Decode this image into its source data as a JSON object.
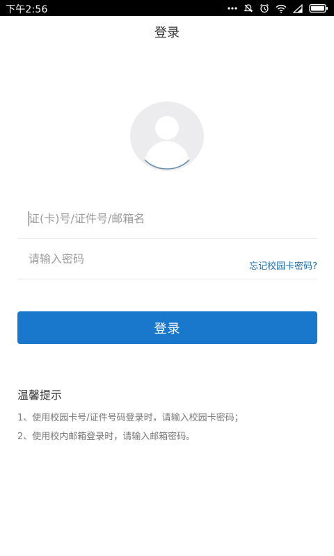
{
  "status_bar": {
    "time": "下午2:56",
    "icons": [
      "more-dots-icon",
      "mute-icon",
      "alarm-icon",
      "wifi-icon",
      "signal-icon",
      "battery-icon"
    ]
  },
  "header": {
    "title": "登录"
  },
  "avatar": {
    "icon": "default-avatar-icon"
  },
  "form": {
    "account_placeholder": "证(卡)号/证件号/邮箱名",
    "account_value": "",
    "password_placeholder": "请输入密码",
    "password_value": "",
    "forgot_label": "忘记校园卡密码?",
    "login_label": "登录"
  },
  "tips": {
    "title": "温馨提示",
    "items": [
      "1、使用校园卡号/证件号码登录时，请输入校园卡密码；",
      "2、使用校内邮箱登录时，请输入邮箱密码。"
    ]
  },
  "colors": {
    "primary": "#1a78cc",
    "link": "#1b6fae",
    "status_bar": "#000000"
  }
}
